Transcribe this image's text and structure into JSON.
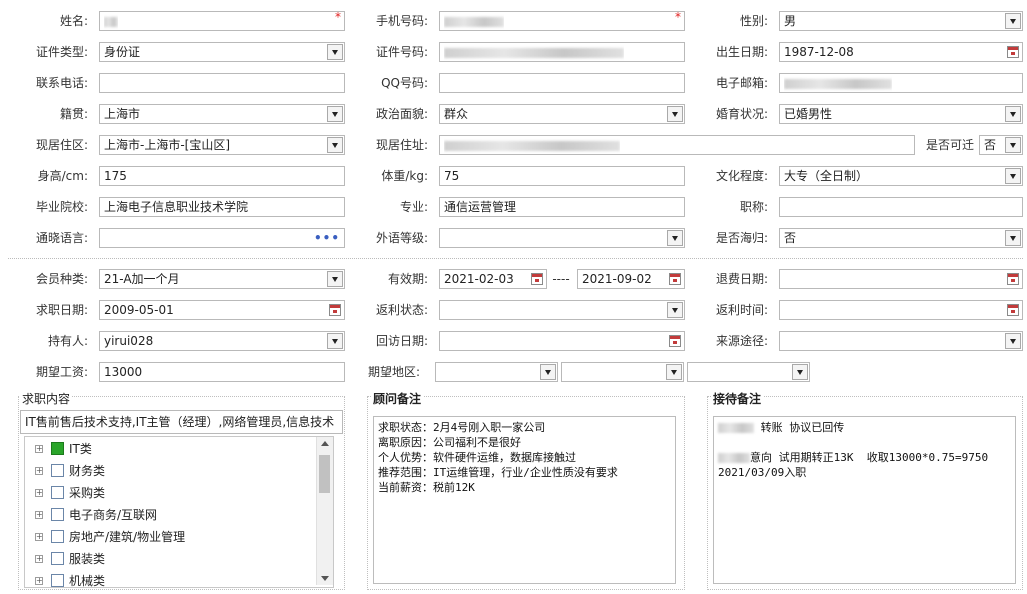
{
  "row1": {
    "name_label": "姓名:",
    "required": "*",
    "phone_label": "手机号码:",
    "gender_label": "性别:",
    "gender_value": "男"
  },
  "row2": {
    "id_type_label": "证件类型:",
    "id_type_value": "身份证",
    "id_no_label": "证件号码:",
    "birth_label": "出生日期:",
    "birth_value": "1987-12-08"
  },
  "row3": {
    "tel_label": "联系电话:",
    "qq_label": "QQ号码:",
    "email_label": "电子邮箱:"
  },
  "row4": {
    "native_label": "籍贯:",
    "native_value": "上海市",
    "politics_label": "政治面貌:",
    "politics_value": "群众",
    "marital_label": "婚育状况:",
    "marital_value": "已婚男性"
  },
  "row5": {
    "residence_label": "现居住区:",
    "residence_value": "上海市-上海市-[宝山区]",
    "address_label": "现居住址:",
    "relocate_label": "是否可迁",
    "relocate_value": "否"
  },
  "row6": {
    "height_label": "身高/cm:",
    "height_value": "175",
    "weight_label": "体重/kg:",
    "weight_value": "75",
    "education_label": "文化程度:",
    "education_value": "大专（全日制）"
  },
  "row7": {
    "school_label": "毕业院校:",
    "school_value": "上海电子信息职业技术学院",
    "major_label": "专业:",
    "major_value": "通信运营管理",
    "title_label": "职称:"
  },
  "row8": {
    "language_label": "通晓语言:",
    "language_btn": "•••",
    "foreign_label": "外语等级:",
    "overseas_label": "是否海归:",
    "overseas_value": "否"
  },
  "member": {
    "type_label": "会员种类:",
    "type_value": "21-A加一个月",
    "valid_label": "有效期:",
    "valid_start": "2021-02-03",
    "valid_dash": "----",
    "valid_end": "2021-09-02",
    "refund_label": "退费日期:"
  },
  "job": {
    "date_label": "求职日期:",
    "date_value": "2009-05-01",
    "rebate_status_label": "返利状态:",
    "rebate_time_label": "返利时间:"
  },
  "holder": {
    "holder_label": "持有人:",
    "holder_value": "yirui028",
    "visit_label": "回访日期:",
    "source_label": "来源途径:"
  },
  "expect": {
    "salary_label": "期望工资:",
    "salary_value": "13000",
    "area_label": "期望地区:"
  },
  "job_content": {
    "title": "求职内容",
    "summary": "IT售前售后技术支持,IT主管（经理）,网络管理员,信息技术",
    "tree": [
      {
        "label": "IT类",
        "checked": true
      },
      {
        "label": "财务类",
        "checked": false
      },
      {
        "label": "采购类",
        "checked": false
      },
      {
        "label": "电子商务/互联网",
        "checked": false
      },
      {
        "label": "房地产/建筑/物业管理",
        "checked": false
      },
      {
        "label": "服装类",
        "checked": false
      },
      {
        "label": "机械类",
        "checked": false
      }
    ]
  },
  "advisor": {
    "title": "顾问备注",
    "text": "求职状态：2月4号刚入职一家公司\n离职原因：公司福利不是很好\n个人优势：软件硬件运维，数据库接触过\n推荐范围：IT运维管理，行业/企业性质没有要求\n当前薪资：税前12K"
  },
  "reception": {
    "title": "接待备注",
    "line1": " 转账 协议已回传",
    "line2": "意向 试用期转正13K  收取13000*0.75=9750",
    "line3": "2021/03/09入职"
  }
}
